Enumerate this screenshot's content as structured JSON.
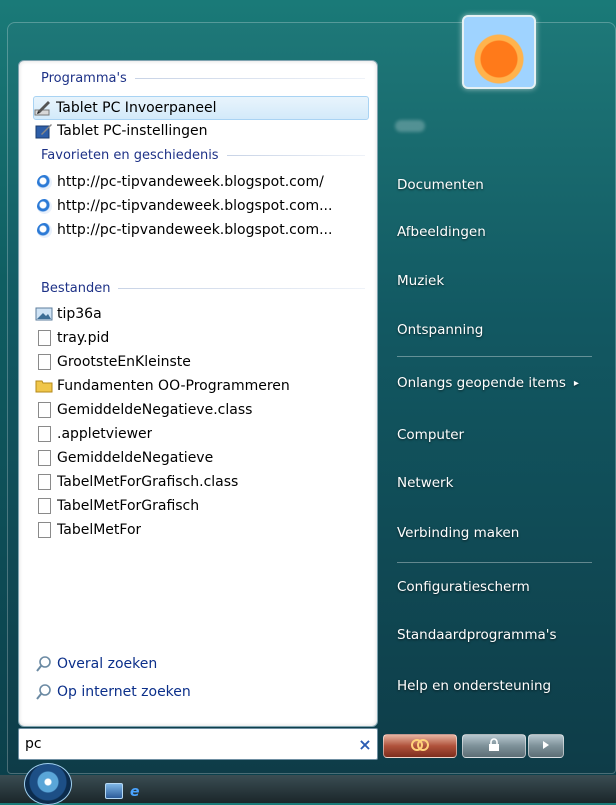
{
  "left": {
    "sections": {
      "programs": "Programma's",
      "favorites": "Favorieten en geschiedenis",
      "files": "Bestanden"
    },
    "programs": [
      {
        "label": "Tablet PC Invoerpaneel",
        "icon": "pen-icon"
      },
      {
        "label": "Tablet PC-instellingen",
        "icon": "tablet-settings-icon"
      }
    ],
    "favorites": [
      {
        "label": "http://pc-tipvandeweek.blogspot.com/",
        "icon": "ie-icon"
      },
      {
        "label": "http://pc-tipvandeweek.blogspot.com...",
        "icon": "ie-icon"
      },
      {
        "label": "http://pc-tipvandeweek.blogspot.com...",
        "icon": "ie-icon"
      }
    ],
    "files": [
      {
        "label": "tip36a",
        "icon": "image-file-icon"
      },
      {
        "label": "tray.pid",
        "icon": "file-icon"
      },
      {
        "label": "GrootsteEnKleinste",
        "icon": "file-icon"
      },
      {
        "label": "Fundamenten OO-Programmeren",
        "icon": "folder-icon"
      },
      {
        "label": "GemiddeldeNegatieve.class",
        "icon": "file-icon"
      },
      {
        "label": ".appletviewer",
        "icon": "file-icon"
      },
      {
        "label": "GemiddeldeNegatieve",
        "icon": "file-icon"
      },
      {
        "label": "TabelMetForGrafisch.class",
        "icon": "file-icon"
      },
      {
        "label": "TabelMetForGrafisch",
        "icon": "file-icon"
      },
      {
        "label": "TabelMetFor",
        "icon": "file-icon"
      }
    ],
    "search_links": {
      "everywhere": "Overal zoeken",
      "internet": "Op internet zoeken"
    },
    "search_value": "pc",
    "clear_glyph": "×"
  },
  "right": {
    "items": {
      "documents": "Documenten",
      "pictures": "Afbeeldingen",
      "music": "Muziek",
      "games": "Ontspanning",
      "recent": "Onlangs geopende items",
      "computer": "Computer",
      "network": "Netwerk",
      "connect": "Verbinding maken",
      "control_panel": "Configuratiescherm",
      "default_programs": "Standaardprogramma's",
      "help": "Help en ondersteuning"
    },
    "recent_arrow": "▸"
  },
  "colors": {
    "section_header": "#1e3287",
    "search_link": "#0b2f8a",
    "selection": "#d3eafa"
  }
}
